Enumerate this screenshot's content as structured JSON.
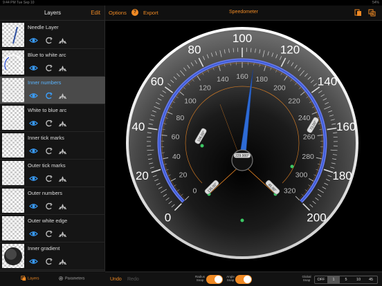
{
  "status_bar": {
    "time": "9:44 PM  Tue Sep 10",
    "battery": "54%"
  },
  "sidebar": {
    "title": "Layers",
    "edit_label": "Edit",
    "layers": [
      {
        "name": "Needle Layer",
        "selected": false
      },
      {
        "name": "Blue to white arc",
        "selected": false
      },
      {
        "name": "Inner numbers",
        "selected": true
      },
      {
        "name": "White to blue arc",
        "selected": false
      },
      {
        "name": "Inner tick marks",
        "selected": false
      },
      {
        "name": "Outer tick marks",
        "selected": false
      },
      {
        "name": "Outer numbers",
        "selected": false
      },
      {
        "name": "Outer white edge",
        "selected": false
      },
      {
        "name": "Inner gradient",
        "selected": false
      }
    ],
    "tabs": {
      "layers": "Layers",
      "parameters": "Parameters"
    }
  },
  "toolbar": {
    "options_label": "Options",
    "help_label": "?",
    "export_label": "Export",
    "document_title": "Speedometer"
  },
  "gauge": {
    "outer_numbers": [
      "0",
      "20",
      "40",
      "60",
      "80",
      "100",
      "120",
      "140",
      "160",
      "180",
      "200"
    ],
    "inner_numbers": [
      "0",
      "20",
      "40",
      "60",
      "80",
      "100",
      "120",
      "140",
      "160",
      "180",
      "200",
      "220",
      "240",
      "260",
      "280",
      "300",
      "320"
    ],
    "needle_value": 105,
    "outer_min": 0,
    "outer_max": 200,
    "start_angle_deg": 225,
    "end_angle_deg": -45,
    "labels": {
      "center": "229.900°",
      "handle_left": "135.00°",
      "handle_right": "45.00°",
      "handle_top_left": "106.00°",
      "handle_top_right": "73.00°"
    },
    "colors": {
      "accent": "#f08a24",
      "needle": "#2d6bd6",
      "arc": "#3b5bd9",
      "number": "#ffffff",
      "inner_number": "#bbbbbb"
    }
  },
  "bottom": {
    "undo_label": "Undo",
    "redo_label": "Redo",
    "radius_snap_label": "Radius Snap",
    "angle_snap_label": "Angle Snap",
    "global_snap_label": "Global Snap",
    "snap_options": [
      "OFF",
      "1",
      "5",
      "10",
      "45"
    ],
    "snap_selected": "1"
  }
}
